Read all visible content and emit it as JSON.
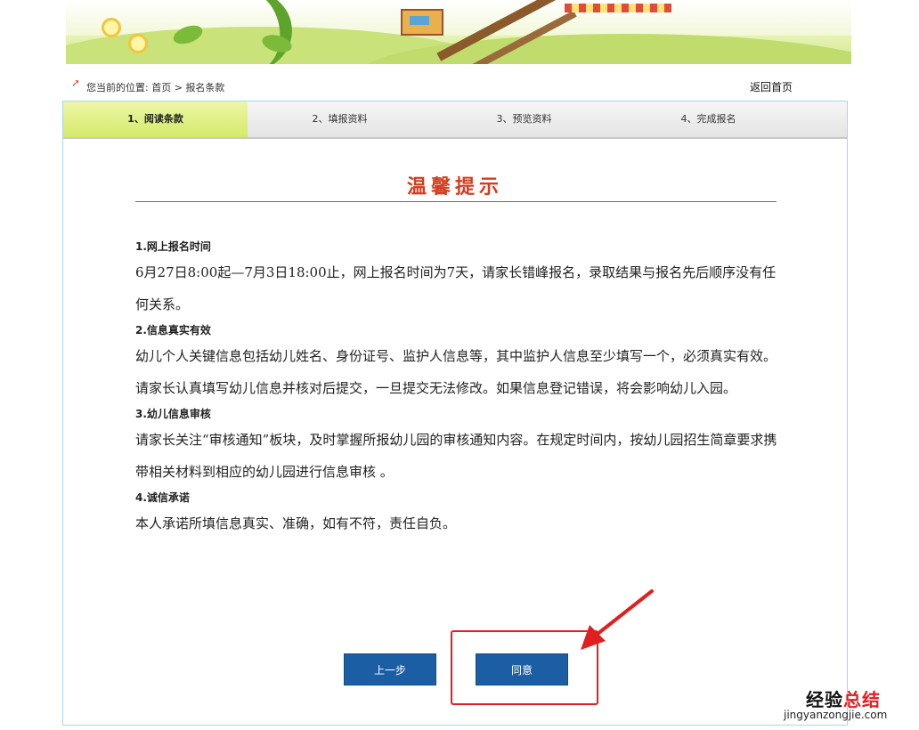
{
  "breadcrumb": {
    "prefix": "您当前的位置:",
    "home": "首页",
    "separator": ">",
    "current": "报名条款"
  },
  "back_home_label": "返回首页",
  "steps": [
    {
      "label": "1、阅读条款",
      "active": true
    },
    {
      "label": "2、填报资料",
      "active": false
    },
    {
      "label": "3、预览资料",
      "active": false
    },
    {
      "label": "4、完成报名",
      "active": false
    }
  ],
  "notice": {
    "title": "温馨提示",
    "sections": [
      {
        "heading": "1.网上报名时间",
        "paragraphs": [
          "6月27日8:00起—7月3日18:00止，网上报名时间为7天，请家长错峰报名，录取结果与报名先后顺序没有任何关系。"
        ]
      },
      {
        "heading": "2.信息真实有效",
        "paragraphs": [
          "幼儿个人关键信息包括幼儿姓名、身份证号、监护人信息等，其中监护人信息至少填写一个，必须真实有效。",
          "请家长认真填写幼儿信息并核对后提交，一旦提交无法修改。如果信息登记错误，将会影响幼儿入园。"
        ]
      },
      {
        "heading": "3.幼儿信息审核",
        "paragraphs": [
          "请家长关注“审核通知”板块，及时掌握所报幼儿园的审核通知内容。在规定时间内，按幼儿园招生简章要求携带相关材料到相应的幼儿园进行信息审核 。"
        ]
      },
      {
        "heading": "4.诚信承诺",
        "paragraphs": [
          "本人承诺所填信息真实、准确，如有不符，责任自负。"
        ]
      }
    ]
  },
  "buttons": {
    "prev": "上一步",
    "agree": "同意"
  },
  "watermark": {
    "title_a": "经验",
    "title_b": "总结",
    "url": "jingyanzongjie.com"
  },
  "colors": {
    "accent_red": "#d23e1e",
    "button_blue": "#1b5ea3",
    "active_step": "#d4ea6a",
    "panel_border": "#a8d7ef",
    "annotation_red": "#e02020"
  }
}
